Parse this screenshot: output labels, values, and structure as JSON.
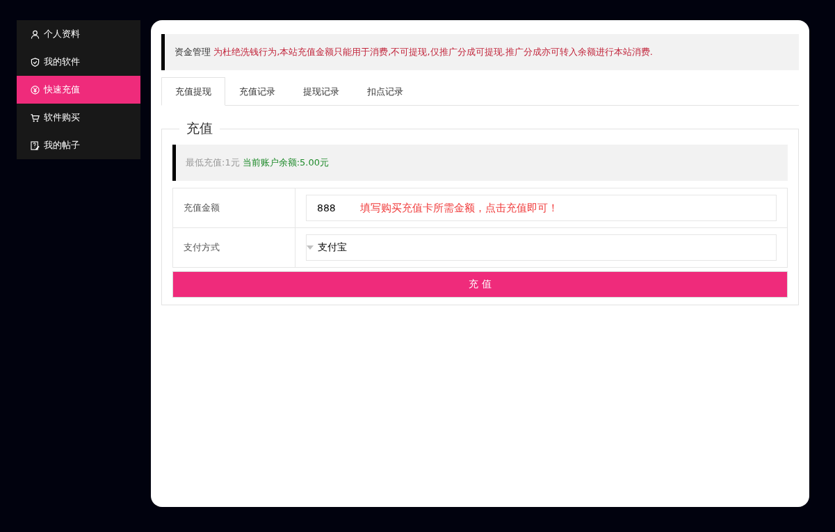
{
  "sidebar": {
    "items": [
      {
        "label": "个人资料",
        "selected": false
      },
      {
        "label": "我的软件",
        "selected": false
      },
      {
        "label": "快速充值",
        "selected": true
      },
      {
        "label": "软件购买",
        "selected": false
      },
      {
        "label": "我的帖子",
        "selected": false
      }
    ]
  },
  "notice": {
    "title": "资金管理",
    "message": "为杜绝洗钱行为,本站充值金额只能用于消费,不可提现,仅推广分成可提现.推广分成亦可转入余额进行本站消费."
  },
  "tabs": [
    {
      "label": "充值提现",
      "selected": true
    },
    {
      "label": "充值记录",
      "selected": false
    },
    {
      "label": "提现记录",
      "selected": false
    },
    {
      "label": "扣点记录",
      "selected": false
    }
  ],
  "recharge": {
    "legend": "充值",
    "min_note": "最低充值:1元",
    "balance_note": "当前账户余额:5.00元",
    "rows": [
      {
        "kind": "input",
        "label": "充值金额",
        "value": "888",
        "hint": "填写购买充值卡所需金额，点击充值即可！"
      },
      {
        "kind": "select",
        "label": "支付方式",
        "value": "支付宝"
      }
    ],
    "submit": "充 值"
  }
}
